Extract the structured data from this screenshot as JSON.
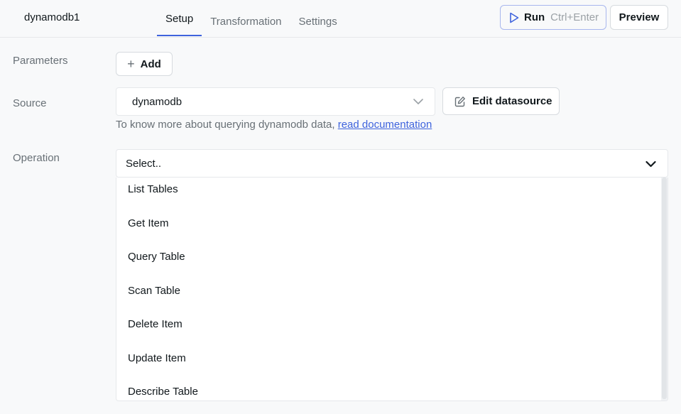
{
  "header": {
    "query_name": "dynamodb1",
    "tabs": [
      {
        "label": "Setup",
        "active": true
      },
      {
        "label": "Transformation",
        "active": false
      },
      {
        "label": "Settings",
        "active": false
      }
    ],
    "run": {
      "label": "Run",
      "shortcut": "Ctrl+Enter",
      "icon": "play-icon"
    },
    "preview_label": "Preview"
  },
  "parameters": {
    "label": "Parameters",
    "add_label": "Add",
    "add_icon": "plus-icon"
  },
  "source": {
    "label": "Source",
    "value": "dynamodb",
    "edit_label": "Edit datasource",
    "edit_icon": "edit-icon",
    "doc_text": "To know more about querying dynamodb data, ",
    "doc_link": "read documentation"
  },
  "operation": {
    "label": "Operation",
    "placeholder": "Select..",
    "options": [
      "List Tables",
      "Get Item",
      "Query Table",
      "Scan Table",
      "Delete Item",
      "Update Item",
      "Describe Table"
    ]
  },
  "colors": {
    "accent": "#3e63dd",
    "muted_text": "#687076",
    "border": "#d7dbdf"
  }
}
